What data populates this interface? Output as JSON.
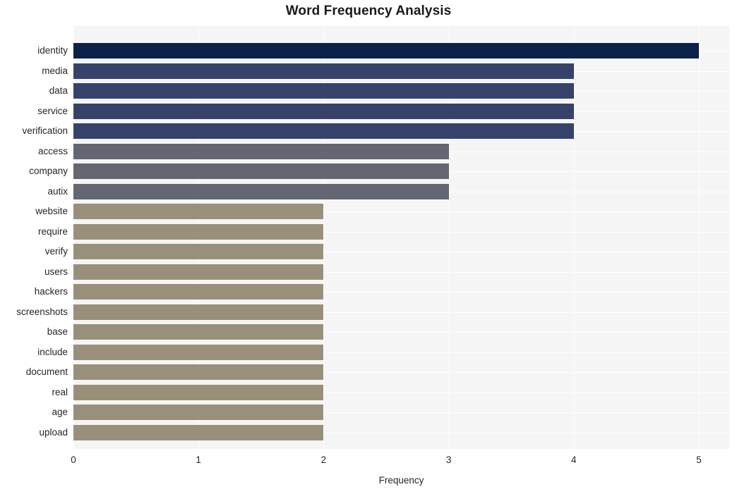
{
  "chart_data": {
    "type": "bar",
    "orientation": "horizontal",
    "title": "Word Frequency Analysis",
    "xlabel": "Frequency",
    "ylabel": "",
    "categories": [
      "identity",
      "media",
      "data",
      "service",
      "verification",
      "access",
      "company",
      "autix",
      "website",
      "require",
      "verify",
      "users",
      "hackers",
      "screenshots",
      "base",
      "include",
      "document",
      "real",
      "age",
      "upload"
    ],
    "values": [
      5,
      4,
      4,
      4,
      4,
      3,
      3,
      3,
      2,
      2,
      2,
      2,
      2,
      2,
      2,
      2,
      2,
      2,
      2,
      2
    ],
    "bar_colors": [
      "#0a2148",
      "#37426b",
      "#37426b",
      "#37426b",
      "#37426b",
      "#646672",
      "#646672",
      "#646672",
      "#98907a",
      "#98907a",
      "#98907a",
      "#98907a",
      "#98907a",
      "#98907a",
      "#98907a",
      "#98907a",
      "#98907a",
      "#98907a",
      "#98907a",
      "#98907a"
    ],
    "xlim": [
      0,
      5
    ],
    "xticks": [
      0,
      1,
      2,
      3,
      4,
      5
    ],
    "xtick_labels": [
      "0",
      "1",
      "2",
      "3",
      "4",
      "5"
    ],
    "grid": true,
    "grid_color": "#ffffff",
    "plot_background": "#f5f5f6",
    "figure_background": "#ffffff",
    "legend": null,
    "style": "seaborn-darkgrid"
  }
}
